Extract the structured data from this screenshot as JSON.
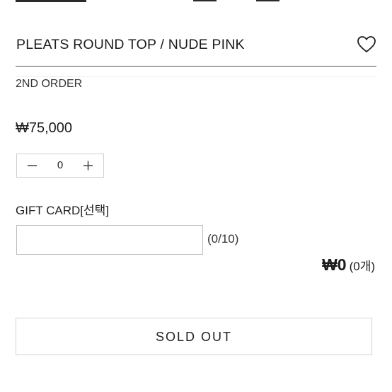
{
  "product": {
    "title": "PLEATS ROUND TOP / NUDE PINK",
    "subtitle": "2ND ORDER",
    "price": "₩75,000"
  },
  "quantity": {
    "value": "0",
    "minus_icon": "minus-icon",
    "plus_icon": "plus-icon"
  },
  "option": {
    "label": "GIFT CARD[선택]",
    "value": "",
    "char_count": "(0/10)"
  },
  "total": {
    "amount": "₩0",
    "count": "(0개)"
  },
  "actions": {
    "wishlist_icon": "heart-icon",
    "sold_out_label": "SOLD OUT"
  },
  "colors": {
    "text": "#222222",
    "border": "#d4d4d4",
    "divider": "#555555",
    "background": "#ffffff"
  }
}
